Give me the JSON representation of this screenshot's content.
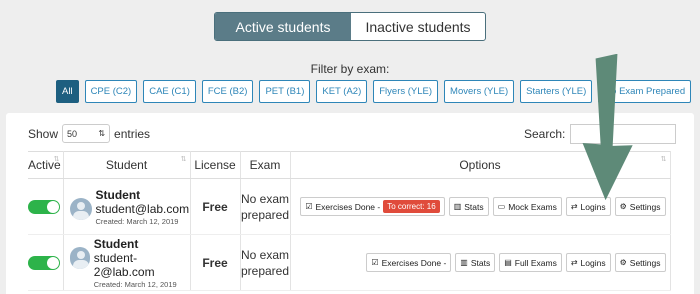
{
  "tabs": {
    "active": "Active students",
    "inactive": "Inactive students"
  },
  "filter": {
    "title": "Filter by exam:",
    "chips": [
      "All",
      "CPE (C2)",
      "CAE (C1)",
      "FCE (B2)",
      "PET (B1)",
      "KET (A2)",
      "Flyers (YLE)",
      "Movers (YLE)",
      "Starters (YLE)",
      "No Exam Prepared"
    ]
  },
  "table_controls": {
    "show_label": "Show",
    "entries_value": "50",
    "entries_label": "entries",
    "search_label": "Search:"
  },
  "columns": {
    "active": "Active",
    "student": "Student",
    "license": "License",
    "exam": "Exam",
    "options": "Options"
  },
  "rows": [
    {
      "name": "Student",
      "email": "student@lab.com",
      "created": "Created: March 12, 2019",
      "license": "Free",
      "exam_line1": "No exam",
      "exam_line2": "prepared",
      "exercises": "Exercises Done -",
      "correct_badge": "To correct: 16",
      "stats": "Stats",
      "exams": "Mock Exams",
      "logins": "Logins",
      "settings": "Settings"
    },
    {
      "name": "Student",
      "email": "student-2@lab.com",
      "created": "Created: March 12, 2019",
      "license": "Free",
      "exam_line1": "No exam",
      "exam_line2": "prepared",
      "exercises": "Exercises Done -",
      "stats": "Stats",
      "exams": "Full Exams",
      "logins": "Logins",
      "settings": "Settings"
    }
  ],
  "colors": {
    "active_tab": "#5b7c88",
    "chip": "#2e86b8",
    "toggle": "#2db34a",
    "badge": "#e04b3b",
    "arrow": "#5e8a78"
  }
}
